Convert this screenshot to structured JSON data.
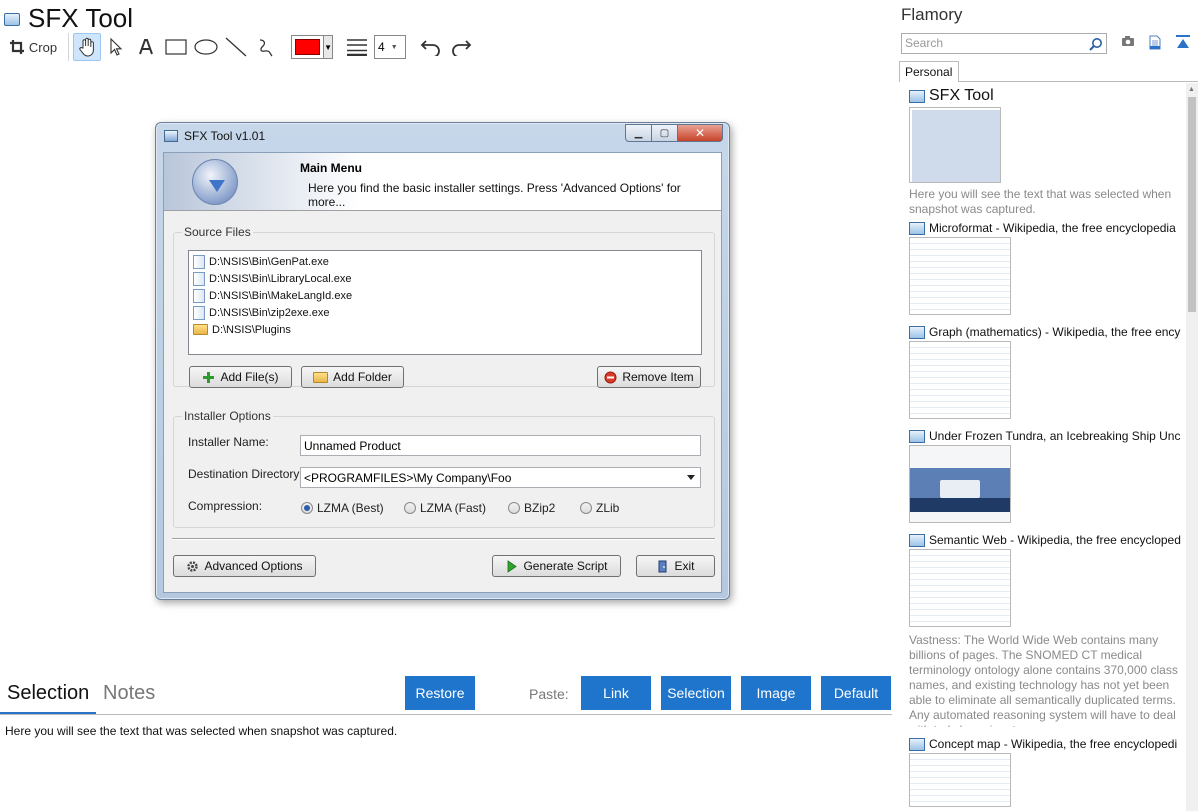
{
  "editor": {
    "title": "SFX Tool",
    "toolbar": {
      "crop_label": "Crop",
      "line_width": "4"
    }
  },
  "dialog": {
    "title": "SFX Tool v1.01",
    "banner": {
      "heading": "Main Menu",
      "subtitle": "Here you find the basic installer settings. Press 'Advanced Options' for more..."
    },
    "source_files": {
      "label": "Source Files",
      "items": [
        {
          "type": "file",
          "path": "D:\\NSIS\\Bin\\GenPat.exe"
        },
        {
          "type": "file",
          "path": "D:\\NSIS\\Bin\\LibraryLocal.exe"
        },
        {
          "type": "file",
          "path": "D:\\NSIS\\Bin\\MakeLangId.exe"
        },
        {
          "type": "file",
          "path": "D:\\NSIS\\Bin\\zip2exe.exe"
        },
        {
          "type": "folder",
          "path": "D:\\NSIS\\Plugins"
        }
      ],
      "add_files": "Add File(s)",
      "add_folder": "Add Folder",
      "remove_item": "Remove Item"
    },
    "installer_options": {
      "label": "Installer Options",
      "name_label": "Installer Name:",
      "name_value": "Unnamed Product",
      "dest_label": "Destination Directory:",
      "dest_value": "<PROGRAMFILES>\\My Company\\Foo",
      "compression_label": "Compression:",
      "compression": [
        {
          "label": "LZMA (Best)",
          "selected": true
        },
        {
          "label": "LZMA (Fast)",
          "selected": false
        },
        {
          "label": "BZip2",
          "selected": false
        },
        {
          "label": "ZLib",
          "selected": false
        }
      ]
    },
    "footer": {
      "advanced": "Advanced Options",
      "generate": "Generate Script",
      "exit": "Exit"
    }
  },
  "bottom": {
    "tabs": [
      "Selection",
      "Notes"
    ],
    "restore": "Restore",
    "paste_label": "Paste:",
    "paste_buttons": [
      "Link",
      "Selection",
      "Image",
      "Default"
    ],
    "selection_text": "Here you will see the text that was selected when snapshot was captured."
  },
  "sidebar": {
    "title": "Flamory",
    "search_placeholder": "Search",
    "tab": "Personal",
    "items": [
      {
        "title": "SFX Tool",
        "thumb": "sfx",
        "snippet": "Here you will see the text that was selected when snapshot was captured."
      },
      {
        "title": "Microformat - Wikipedia, the free encyclopedia",
        "thumb": "page",
        "snippet": ""
      },
      {
        "title": "Graph (mathematics) - Wikipedia, the free ency",
        "thumb": "page",
        "snippet": ""
      },
      {
        "title": "Under Frozen Tundra, an Icebreaking Ship Unco",
        "thumb": "ship",
        "snippet": ""
      },
      {
        "title": "Semantic Web - Wikipedia, the free encycloped",
        "thumb": "page",
        "snippet": "Vastness: The World Wide Web contains many billions of pages. The SNOMED CT medical terminology ontology alone contains 370,000 class names, and existing technology has not yet been able to eliminate all semantically duplicated terms. Any automated reasoning system will have to deal with truly huge inputs."
      },
      {
        "title": "Concept map - Wikipedia, the free encyclopedi",
        "thumb": "page",
        "snippet": ""
      }
    ]
  },
  "colors": {
    "accent": "#1f75cc",
    "pen": "#ff0000"
  }
}
